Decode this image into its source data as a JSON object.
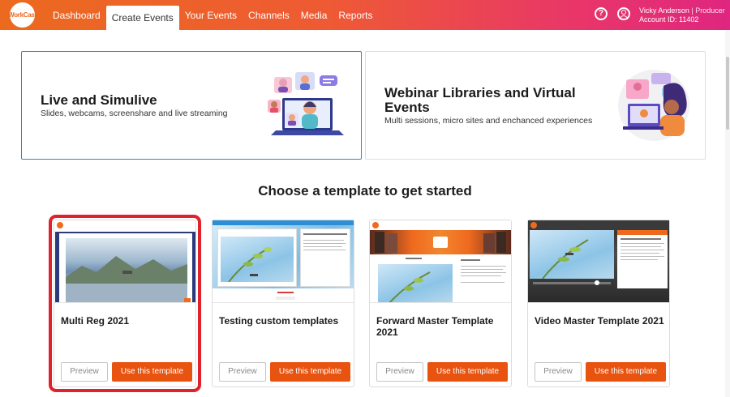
{
  "brand": {
    "logo_text": "WorkCast",
    "accent": "#e8530f",
    "selected_outline": "#e0222c"
  },
  "nav": {
    "items": [
      "Dashboard",
      "Create Events",
      "Your Events",
      "Channels",
      "Media",
      "Reports"
    ],
    "active": "Create Events"
  },
  "header": {
    "help_icon": "question-circle-icon",
    "user_icon": "user-circle-icon",
    "user_name": "Vicky Anderson",
    "user_role": "| Producer",
    "account_id": "Account ID: 11402"
  },
  "event_types": [
    {
      "title": "Live and Simulive",
      "description": "Slides, webcams, screenshare and live streaming",
      "selected": true
    },
    {
      "title": "Webinar Libraries and Virtual Events",
      "description": "Multi sessions, micro sites and enchanced experiences",
      "selected": false
    }
  ],
  "section_title": "Choose a template to get started",
  "templates": [
    {
      "name": "Multi Reg 2021",
      "preview": "Preview",
      "use": "Use this template",
      "selected": true
    },
    {
      "name": "Testing custom templates",
      "preview": "Preview",
      "use": "Use this template",
      "selected": false
    },
    {
      "name": "Forward Master Template 2021",
      "preview": "Preview",
      "use": "Use this template",
      "selected": false
    },
    {
      "name": "Video Master Template 2021",
      "preview": "Preview",
      "use": "Use this template",
      "selected": false
    }
  ]
}
